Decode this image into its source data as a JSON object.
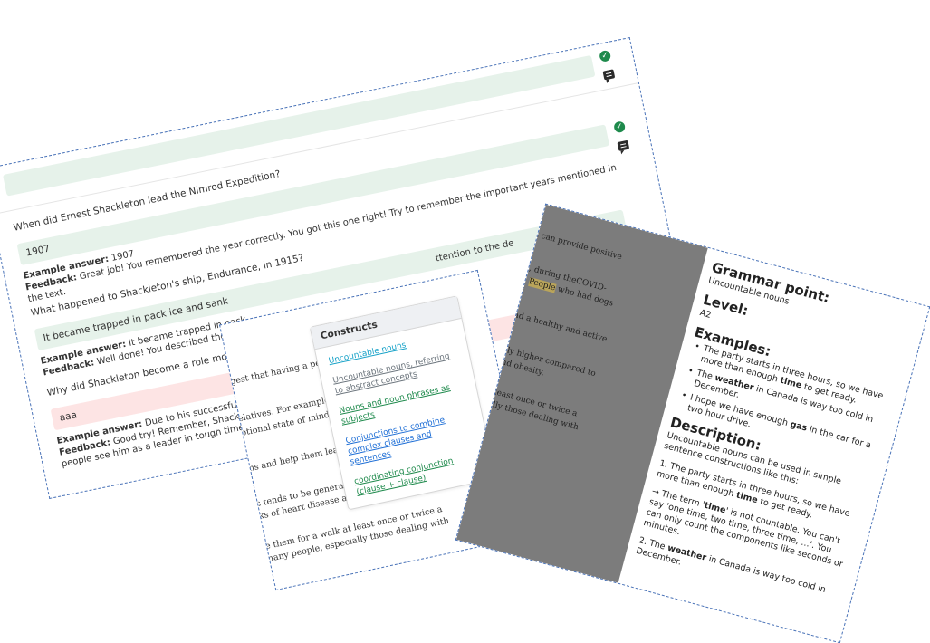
{
  "quiz": {
    "questions": [
      {
        "question": "When did Ernest Shackleton lead the Nimrod Expedition?",
        "answer": "1907",
        "example_label": "Example answer:",
        "example": "1907",
        "feedback_label": "Feedback:",
        "feedback": "Great job! You remembered the year correctly. You got this one right! Try to remember the important years mentioned in the text.",
        "status": "correct"
      },
      {
        "question": "What happened to Shackleton's ship, Endurance, in 1915?",
        "answer": "It became trapped in pack ice and sank",
        "example_label": "Example answer:",
        "example": "It became trapped in pack",
        "feedback_label": "Feedback:",
        "feedback": "Well done! You described the fat",
        "status": "correct"
      },
      {
        "question": "Why did Shackleton become a role model fo",
        "answer": "aaa",
        "example_label": "Example answer:",
        "example": "Due to his successful lea",
        "feedback_label": "Feedback:",
        "feedback": "Good try! Remember, Shackleto",
        "feedback_line2": "people see him as a leader in tough times.",
        "status": "wrong"
      }
    ],
    "trailing_text": "ttention to the de"
  },
  "text_card": {
    "lines": [
      "gest that having a pet can prov",
      "elatives. For example, during th",
      "otional state of mind. People w",
      "ns and help them lead a healthy",
      "s tends to be generally higher",
      "ks of heart disease and obesity.",
      "e them for a walk at least once or twice a",
      "nany people, especially those dealing with"
    ],
    "constructs": {
      "title": "Constructs",
      "items": [
        {
          "label": "Uncountable nouns",
          "color": "#17a2c8"
        },
        {
          "label": "Uncountable nouns, referring to abstract concepts",
          "color": "#6c757d"
        },
        {
          "label": "Nouns and noun phrases as subjects",
          "color": "#1e8a4c"
        },
        {
          "label": "Conjunctions to combine complex clauses and sentences",
          "color": "#1f6fd6"
        },
        {
          "label": "coordinating conjunction (clause + clause)",
          "color": "#1e8a4c"
        }
      ]
    }
  },
  "grammar_card": {
    "gray_lines": [
      "et can provide positive",
      "le, during theCOVID-",
      "d.",
      "People",
      "who had dogs",
      "ead a healthy and active",
      "ally higher compared to",
      "and obesity.",
      "t least once or twice a",
      "ially those dealing with"
    ],
    "grammar_point_heading": "Grammar point:",
    "grammar_point": "Uncountable nouns",
    "level_heading": "Level:",
    "level": "A2",
    "examples_heading": "Examples:",
    "examples": [
      {
        "pre": "The party starts in three hours, so we have more than enough ",
        "bold": "time",
        "post": " to get ready."
      },
      {
        "pre": "The ",
        "bold": "weather",
        "post": " in Canada is way too cold in December."
      },
      {
        "pre": "I hope we have enough ",
        "bold": "gas",
        "post": " in the car for a two hour drive."
      }
    ],
    "description_heading": "Description:",
    "description_intro": "Uncountable nouns can be used in simple sentence constructions like this:",
    "desc_1_pre": "1. The party starts in three hours, so we have more than enough ",
    "desc_1_bold": "time",
    "desc_1_post": " to get ready.",
    "desc_note_pre": "→ The term '",
    "desc_note_bold": "time",
    "desc_note_post": "' is not countable. You can't say 'one time, two time, three time, …'. You can only count the components like seconds or minutes.",
    "desc_2_pre": "2. The ",
    "desc_2_bold": "weather",
    "desc_2_post": " in Canada is way too cold in December."
  }
}
